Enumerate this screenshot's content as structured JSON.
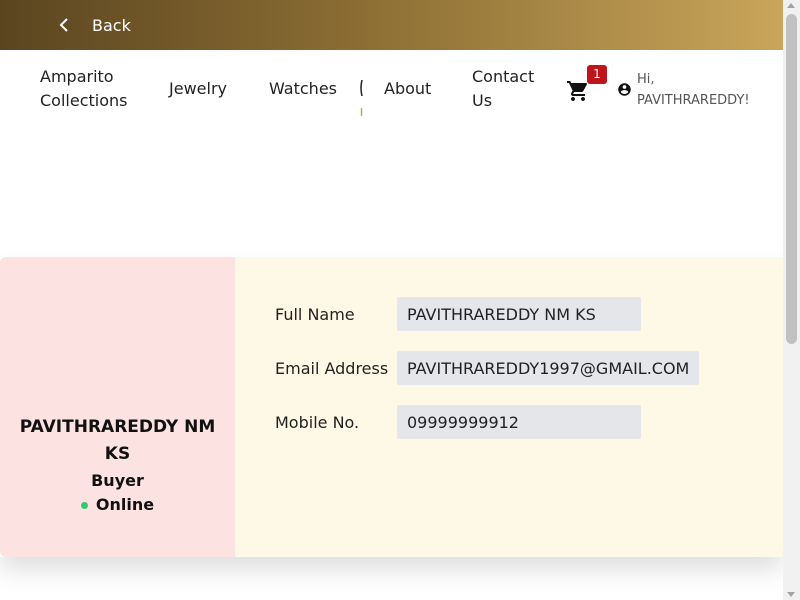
{
  "topbar": {
    "back_label": "Back"
  },
  "nav": {
    "brand_line1": "Amparito",
    "brand_line2": "Collections",
    "jewelry": "Jewelry",
    "watches": "Watches",
    "about": "About",
    "contact_line1": "Contact",
    "contact_line2": "Us",
    "cart_count": "1",
    "greeting_line1": "Hi,",
    "greeting_line2": "PAVITHRAREDDY!"
  },
  "profile": {
    "name": "PAVITHRAREDDY NM KS",
    "role": "Buyer",
    "status": "Online"
  },
  "fields": {
    "full_name_label": "Full Name",
    "full_name_value": "PAVITHRAREDDY NM KS",
    "email_label": "Email Address",
    "email_value": "PAVITHRAREDDY1997@GMAIL.COM",
    "mobile_label": "Mobile No.",
    "mobile_value": "09999999912"
  },
  "colors": {
    "topbar_start": "#5a4520",
    "topbar_end": "#c8a55a",
    "left_panel": "#fde2e2",
    "right_panel": "#fdf9e6",
    "badge": "#c0141c",
    "online": "#2ecc71"
  },
  "icons": {
    "back": "chevron-left-icon",
    "cart": "cart-icon",
    "user": "user-circle-icon"
  }
}
